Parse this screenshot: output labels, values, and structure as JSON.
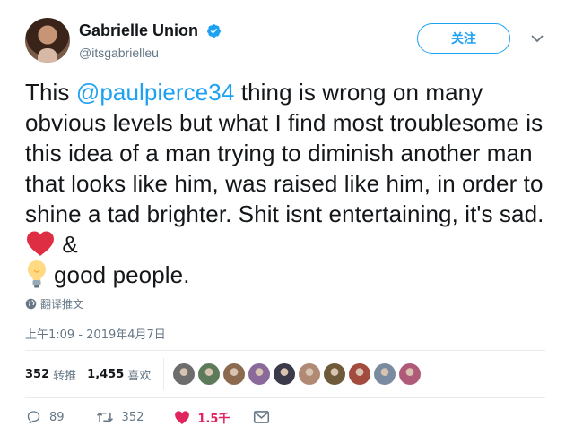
{
  "user": {
    "display_name": "Gabrielle Union",
    "handle": "@itsgabrielleu",
    "verified": true
  },
  "header": {
    "follow_label": "关注"
  },
  "tweet": {
    "text_before_mention": "This ",
    "mention": "@paulpierce34",
    "text_after_mention": " thing is wrong on many obvious levels but what I find most troublesome is this idea of a man trying to diminish another man that looks like him, was raised like him, in order to shine a tad brighter. Shit isnt entertaining, it's sad. ",
    "emoji_1": "red-heart",
    "text_between_emoji": " &",
    "emoji_2": "light-bulb",
    "text_end": "good people."
  },
  "translate_label": "翻译推文",
  "timestamp": "上午1:09 - 2019年4月7日",
  "stats": {
    "retweets_count": "352",
    "retweets_label": "转推",
    "likes_count": "1,455",
    "likes_label": "喜欢",
    "liker_avatars": [
      "#6d6d6d",
      "#5d7a5a",
      "#8c6a4f",
      "#8a6a9a",
      "#3a3a4a",
      "#b08a74",
      "#6f5a3a",
      "#a24b3e",
      "#7a8aa0",
      "#b05a7a"
    ]
  },
  "actions": {
    "replies": "89",
    "retweets": "352",
    "likes": "1.5千"
  },
  "colors": {
    "accent": "#1da1f2",
    "like": "#e0245e",
    "secondary_text": "#657786"
  }
}
